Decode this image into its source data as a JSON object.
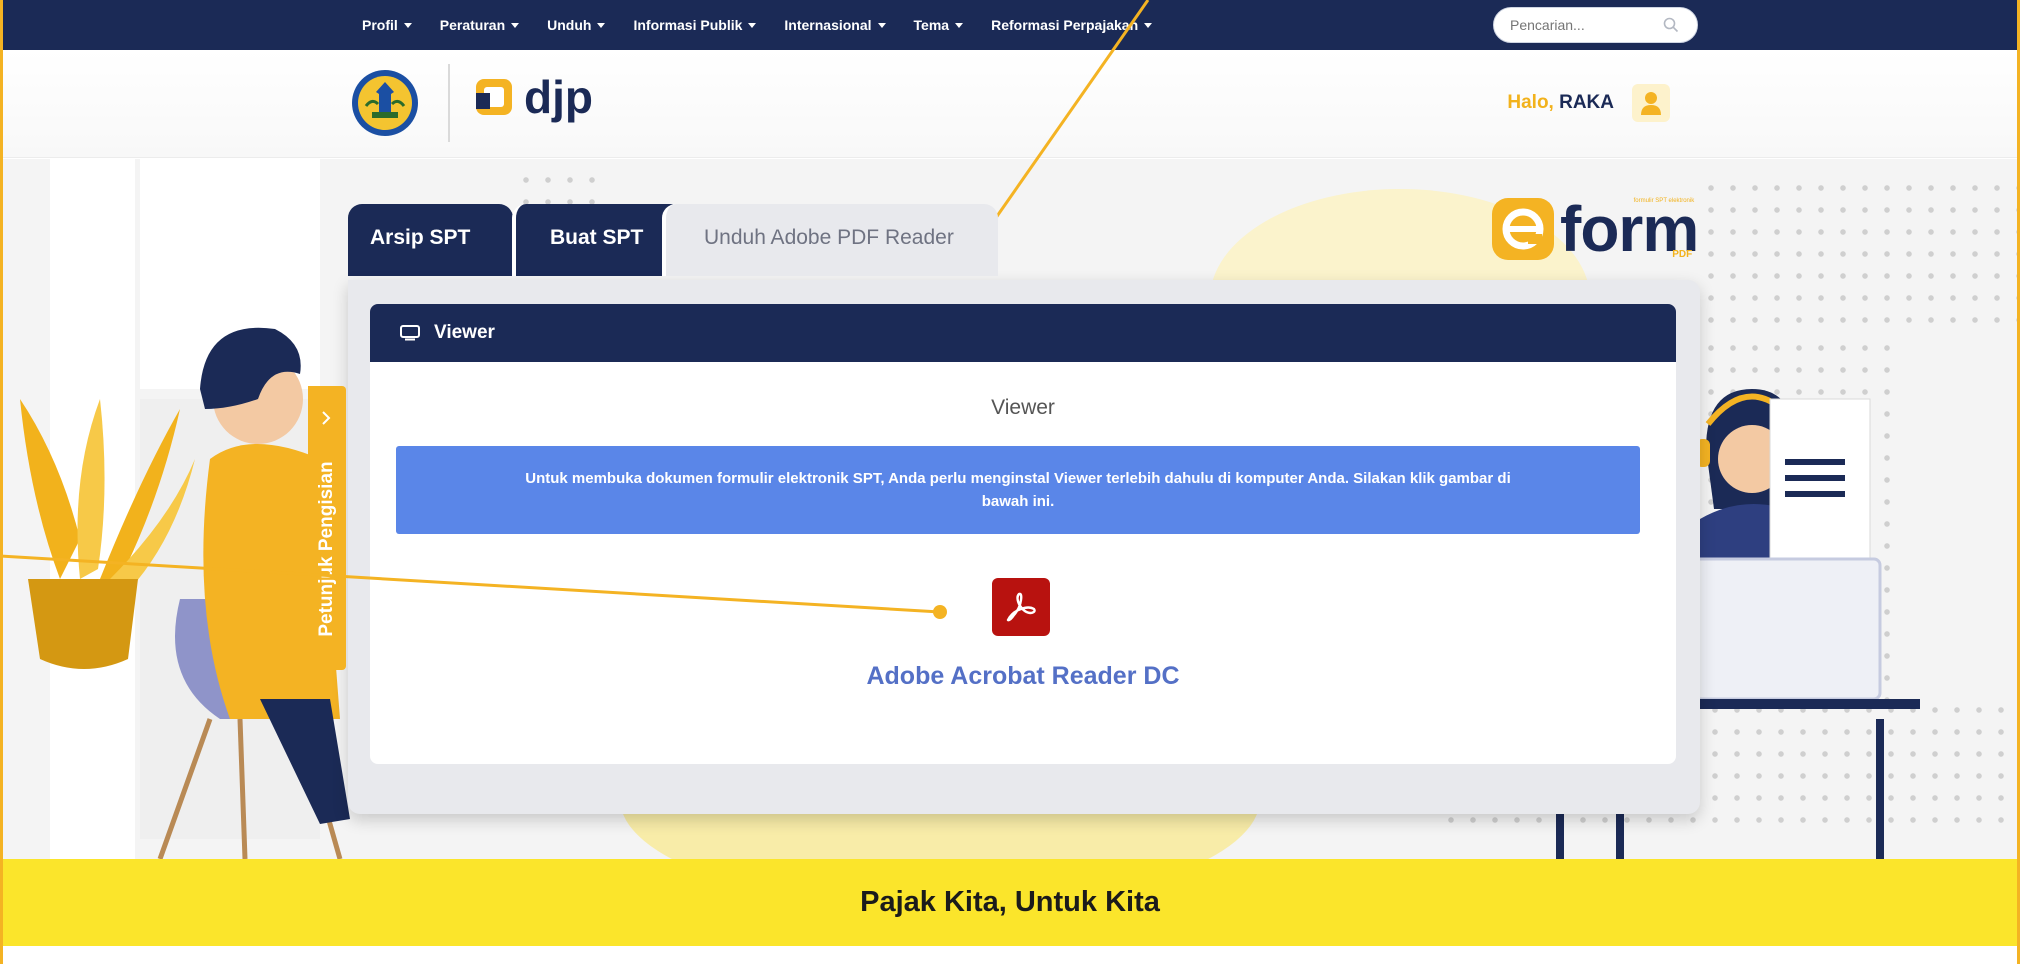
{
  "nav": {
    "items": [
      {
        "label": "Profil",
        "dropdown": true
      },
      {
        "label": "Peraturan",
        "dropdown": true
      },
      {
        "label": "Unduh",
        "dropdown": true
      },
      {
        "label": "Informasi Publik",
        "dropdown": true
      },
      {
        "label": "Internasional",
        "dropdown": true
      },
      {
        "label": "Tema",
        "dropdown": true
      },
      {
        "label": "Reformasi Perpajakan",
        "dropdown": true
      }
    ],
    "search_placeholder": "Pencarian..."
  },
  "header": {
    "brand": "djp",
    "greeting": "Halo,",
    "username": "RAKA"
  },
  "eform": {
    "brand": "form",
    "tagline": "formulir SPT elektronik",
    "badge": "PDF"
  },
  "tabs": [
    {
      "label": "Arsip SPT",
      "active": false
    },
    {
      "label": "Buat SPT",
      "active": false
    },
    {
      "label": "Unduh Adobe PDF Reader",
      "active": true
    }
  ],
  "viewer": {
    "header": "Viewer",
    "title": "Viewer",
    "info": "Untuk membuka dokumen formulir elektronik SPT, Anda perlu menginstal Viewer terlebih dahulu di komputer Anda. Silakan klik gambar di bawah ini.",
    "download_label": "Adobe Acrobat Reader DC"
  },
  "side_tab": {
    "label": "Petunjuk Pengisian"
  },
  "footer": {
    "slogan": "Pajak Kita, Untuk Kita"
  },
  "colors": {
    "navy": "#1b2a56",
    "accent_yellow": "#f4b323",
    "info_blue": "#5a86e8",
    "acrobat_red": "#b8120f",
    "link_blue": "#5470c6",
    "footer_yellow": "#fbe52b"
  },
  "icons": {
    "search": "search-icon",
    "user": "user-icon",
    "monitor": "monitor-icon",
    "acrobat": "adobe-acrobat-icon",
    "chevron": "chevron-right-icon"
  }
}
